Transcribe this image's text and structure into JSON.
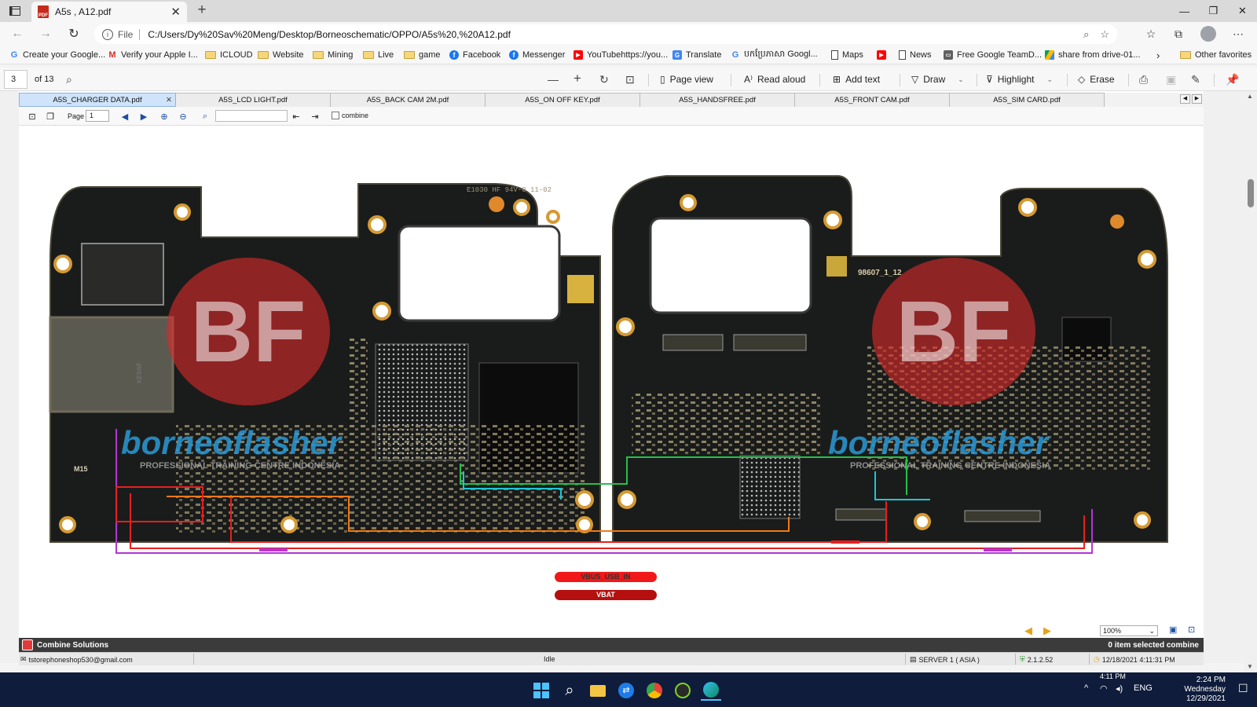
{
  "browser": {
    "tab_title": "A5s , A12.pdf",
    "url_scheme": "File",
    "url": "C:/Users/Dy%20Sav%20Meng/Desktop/Borneoschematic/OPPO/A5s%20,%20A12.pdf"
  },
  "favorites": [
    {
      "label": "Create your Google...",
      "icon": "google-icon"
    },
    {
      "label": "Verify your Apple I...",
      "icon": "gmail-icon"
    },
    {
      "label": "ICLOUD",
      "icon": "folder-icon"
    },
    {
      "label": "Website",
      "icon": "folder-icon"
    },
    {
      "label": "Mining",
      "icon": "folder-icon"
    },
    {
      "label": "Live",
      "icon": "folder-icon"
    },
    {
      "label": "game",
      "icon": "folder-icon"
    },
    {
      "label": "Facebook",
      "icon": "facebook-icon"
    },
    {
      "label": "Messenger",
      "icon": "facebook-icon"
    },
    {
      "label": "YouTubehttps://you...",
      "icon": "youtube-icon"
    },
    {
      "label": "Translate",
      "icon": "translate-icon"
    },
    {
      "label": "បកប្រែភាសា Googl...",
      "icon": "google-icon"
    },
    {
      "label": "Maps",
      "icon": "page-icon"
    },
    {
      "label": "",
      "icon": "youtube-icon"
    },
    {
      "label": "News",
      "icon": "page-icon"
    },
    {
      "label": "Free Google TeamD...",
      "icon": "site-icon"
    },
    {
      "label": "share from drive-01...",
      "icon": "drive-icon"
    }
  ],
  "favorites_other": "Other favorites",
  "pdf_toolbar": {
    "page": "3",
    "page_count": "of 13",
    "page_view": "Page view",
    "read_aloud": "Read aloud",
    "add_text": "Add text",
    "draw": "Draw",
    "highlight": "Highlight",
    "erase": "Erase"
  },
  "viewer": {
    "tabs": [
      "A5S_CHARGER DATA.pdf",
      "A5S_LCD LIGHT.pdf",
      "A5S_BACK CAM 2M.pdf",
      "A5S_ON OFF KEY.pdf",
      "A5S_HANDSFREE.pdf",
      "A5S_FRONT CAM.pdf",
      "A5S_SIM CARD.pdf"
    ],
    "page_label": "Page",
    "page_value": "1",
    "combine_label": "combine",
    "zoom": "100%"
  },
  "board": {
    "watermark_brand": "borneoflasher",
    "watermark_sub": "PROFESSIONAL TRAINING CENTRE INDONESIA",
    "silk_left": "M15",
    "silk_right": "98607_1_12",
    "silk_chip": "KE96F",
    "silk_top": "E1030 HF 94V-0 11-02"
  },
  "legend": [
    {
      "label": "VBUS_USB_IN",
      "color": "#f01818"
    },
    {
      "label": "VBAT",
      "color": "#b50f0f"
    }
  ],
  "app_bar": {
    "name": "Combine Solutions",
    "selection": "0 item selected combine"
  },
  "status": {
    "email": "tstorephoneshop530@gmail.com",
    "state": "Idle",
    "server": "SERVER 1 ( ASIA )",
    "version": "2.1.2.52",
    "datetime": "12/18/2021 4:11:31 PM",
    "time_overlay": "4:11 PM"
  },
  "taskbar": {
    "lang": "ENG",
    "time": "2:24 PM",
    "day": "Wednesday",
    "date": "12/29/2021"
  },
  "colors": {
    "accent": "#0078d4",
    "trace_red": "#e81e1e",
    "trace_purple": "#b236d6",
    "trace_green": "#22c14a",
    "trace_cyan": "#18c8d8",
    "trace_orange": "#f07a16"
  }
}
